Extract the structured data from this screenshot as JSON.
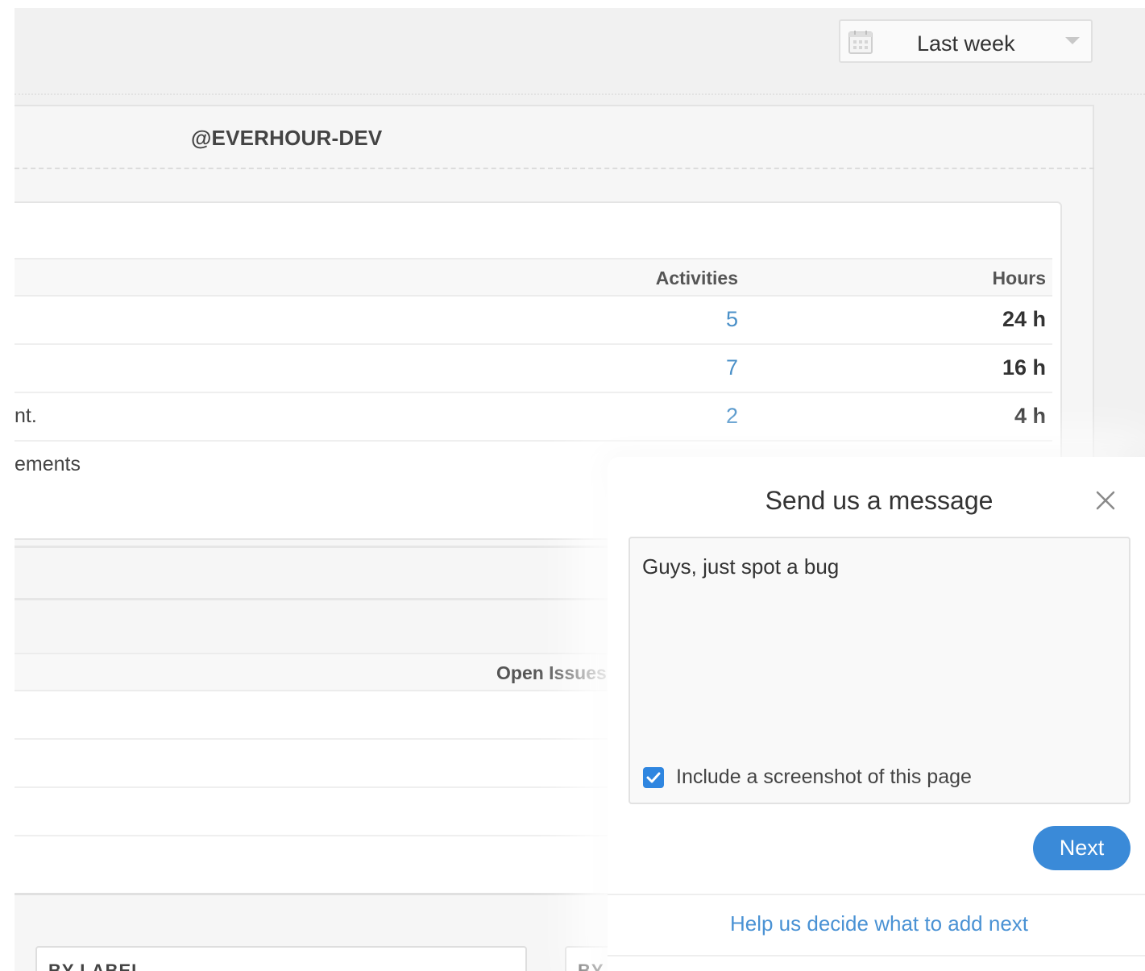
{
  "header": {
    "date_range": {
      "selected": "Last week",
      "icon": "calendar-icon"
    }
  },
  "workspace": {
    "title": "@EVERHOUR-DEV"
  },
  "activity_table": {
    "columns": [
      "Activities",
      "Hours"
    ],
    "rows": [
      {
        "label": "",
        "activities": "5",
        "hours": "24 h"
      },
      {
        "label": "",
        "activities": "7",
        "hours": "16 h"
      },
      {
        "label": "nt.",
        "activities": "2",
        "hours": "4 h"
      },
      {
        "label": "ements",
        "activities": "",
        "hours": ""
      }
    ]
  },
  "issues_table": {
    "columns": [
      "Open Issues"
    ]
  },
  "tiles": {
    "by_label": "BY LABEL",
    "by_other": "BY"
  },
  "message_modal": {
    "title": "Send us a message",
    "message": "Guys, just spot a bug",
    "include_screenshot_label": "Include a screenshot of this page",
    "include_screenshot_checked": true,
    "next_label": "Next",
    "help_link": "Help us decide what to add next"
  },
  "colors": {
    "accent": "#3a8ad8",
    "link": "#4a92d4",
    "checkbox": "#2f86e0"
  }
}
